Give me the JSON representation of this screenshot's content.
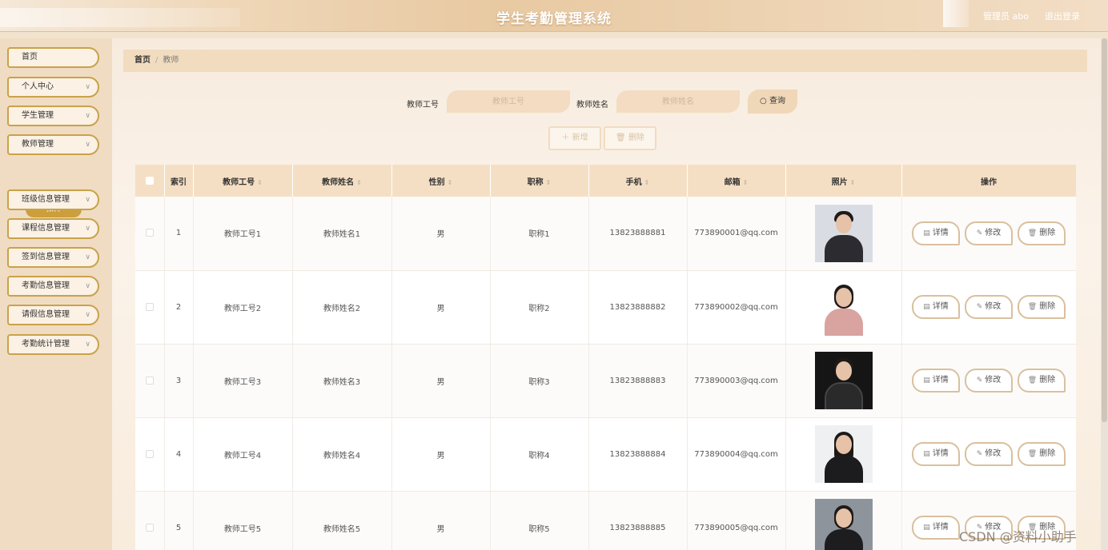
{
  "header": {
    "title": "学生考勤管理系统",
    "user": "管理员 abo",
    "logout": "退出登录"
  },
  "sidebar": {
    "items": [
      {
        "label": "首页"
      },
      {
        "label": "个人中心"
      },
      {
        "label": "学生管理"
      },
      {
        "label": "教师管理"
      },
      {
        "label": "班级信息管理"
      },
      {
        "label": "课程信息管理"
      },
      {
        "label": "签到信息管理"
      },
      {
        "label": "考勤信息管理"
      },
      {
        "label": "请假信息管理"
      },
      {
        "label": "考勤统计管理"
      }
    ],
    "sub_active": "教师"
  },
  "breadcrumb": {
    "home": "首页",
    "current": "教师"
  },
  "search": {
    "id_label": "教师工号",
    "id_placeholder": "教师工号",
    "name_label": "教师姓名",
    "name_placeholder": "教师姓名",
    "query_label": "查询"
  },
  "actions": {
    "add_label": "新增",
    "delete_label": "删除"
  },
  "table": {
    "headers": [
      "索引",
      "教师工号",
      "教师姓名",
      "性别",
      "职称",
      "手机",
      "邮箱",
      "照片",
      "操作"
    ],
    "rows": [
      {
        "index": "1",
        "id": "教师工号1",
        "name": "教师姓名1",
        "gender": "男",
        "title": "职称1",
        "phone": "13823888881",
        "email": "773890001@qq.com"
      },
      {
        "index": "2",
        "id": "教师工号2",
        "name": "教师姓名2",
        "gender": "男",
        "title": "职称2",
        "phone": "13823888882",
        "email": "773890002@qq.com"
      },
      {
        "index": "3",
        "id": "教师工号3",
        "name": "教师姓名3",
        "gender": "男",
        "title": "职称3",
        "phone": "13823888883",
        "email": "773890003@qq.com"
      },
      {
        "index": "4",
        "id": "教师工号4",
        "name": "教师姓名4",
        "gender": "男",
        "title": "职称4",
        "phone": "13823888884",
        "email": "773890004@qq.com"
      },
      {
        "index": "5",
        "id": "教师工号5",
        "name": "教师姓名5",
        "gender": "男",
        "title": "职称5",
        "phone": "13823888885",
        "email": "773890005@qq.com"
      }
    ],
    "row_actions": {
      "detail": "详情",
      "edit": "修改",
      "delete": "删除"
    }
  },
  "watermark": "CSDN @资料小助手",
  "colors": {
    "accent": "#c9a24a",
    "header_bg": "#e8c9a2",
    "sidebar_bg": "#f0dcc3"
  }
}
